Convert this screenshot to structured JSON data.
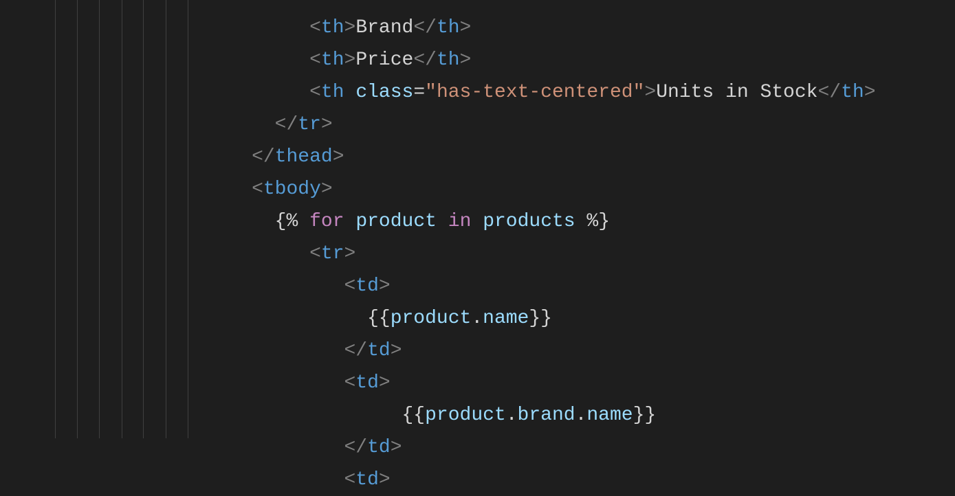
{
  "indent_guides": [
    50,
    82,
    114,
    147,
    178,
    211,
    243
  ],
  "lines": [
    {
      "indent": "                         ",
      "tokens": [
        {
          "cls": "bracket",
          "t": "<"
        },
        {
          "cls": "tag",
          "t": "th"
        },
        {
          "cls": "bracket",
          "t": ">"
        },
        {
          "cls": "text",
          "t": "Brand"
        },
        {
          "cls": "bracket",
          "t": "</"
        },
        {
          "cls": "tag",
          "t": "th"
        },
        {
          "cls": "bracket",
          "t": ">"
        }
      ]
    },
    {
      "indent": "                         ",
      "tokens": [
        {
          "cls": "bracket",
          "t": "<"
        },
        {
          "cls": "tag",
          "t": "th"
        },
        {
          "cls": "bracket",
          "t": ">"
        },
        {
          "cls": "text",
          "t": "Price"
        },
        {
          "cls": "bracket",
          "t": "</"
        },
        {
          "cls": "tag",
          "t": "th"
        },
        {
          "cls": "bracket",
          "t": ">"
        }
      ]
    },
    {
      "indent": "                         ",
      "tokens": [
        {
          "cls": "bracket",
          "t": "<"
        },
        {
          "cls": "tag",
          "t": "th"
        },
        {
          "cls": "text",
          "t": " "
        },
        {
          "cls": "attr",
          "t": "class"
        },
        {
          "cls": "text",
          "t": "="
        },
        {
          "cls": "string",
          "t": "\"has-text-centered\""
        },
        {
          "cls": "bracket",
          "t": ">"
        },
        {
          "cls": "text",
          "t": "Units in Stock"
        },
        {
          "cls": "bracket",
          "t": "</"
        },
        {
          "cls": "tag",
          "t": "th"
        },
        {
          "cls": "bracket",
          "t": ">"
        }
      ]
    },
    {
      "indent": "                      ",
      "tokens": [
        {
          "cls": "bracket",
          "t": "</"
        },
        {
          "cls": "tag",
          "t": "tr"
        },
        {
          "cls": "bracket",
          "t": ">"
        }
      ]
    },
    {
      "indent": "                    ",
      "tokens": [
        {
          "cls": "bracket",
          "t": "</"
        },
        {
          "cls": "tag",
          "t": "thead"
        },
        {
          "cls": "bracket",
          "t": ">"
        }
      ]
    },
    {
      "indent": "                    ",
      "tokens": [
        {
          "cls": "bracket",
          "t": "<"
        },
        {
          "cls": "tag",
          "t": "tbody"
        },
        {
          "cls": "bracket",
          "t": ">"
        }
      ]
    },
    {
      "indent": "                      ",
      "tokens": [
        {
          "cls": "delim",
          "t": "{% "
        },
        {
          "cls": "keyword",
          "t": "for"
        },
        {
          "cls": "text",
          "t": " "
        },
        {
          "cls": "varname",
          "t": "product"
        },
        {
          "cls": "text",
          "t": " "
        },
        {
          "cls": "keyword",
          "t": "in"
        },
        {
          "cls": "text",
          "t": " "
        },
        {
          "cls": "varname",
          "t": "products"
        },
        {
          "cls": "delim",
          "t": " %}"
        }
      ]
    },
    {
      "indent": "                         ",
      "tokens": [
        {
          "cls": "bracket",
          "t": "<"
        },
        {
          "cls": "tag",
          "t": "tr"
        },
        {
          "cls": "bracket",
          "t": ">"
        }
      ]
    },
    {
      "indent": "                            ",
      "tokens": [
        {
          "cls": "bracket",
          "t": "<"
        },
        {
          "cls": "tag",
          "t": "td"
        },
        {
          "cls": "bracket",
          "t": ">"
        }
      ]
    },
    {
      "indent": "                              ",
      "tokens": [
        {
          "cls": "delim",
          "t": "{{"
        },
        {
          "cls": "varname",
          "t": "product"
        },
        {
          "cls": "text",
          "t": "."
        },
        {
          "cls": "prop",
          "t": "name"
        },
        {
          "cls": "delim",
          "t": "}}"
        }
      ]
    },
    {
      "indent": "                            ",
      "tokens": [
        {
          "cls": "bracket",
          "t": "</"
        },
        {
          "cls": "tag",
          "t": "td"
        },
        {
          "cls": "bracket",
          "t": ">"
        }
      ]
    },
    {
      "indent": "                            ",
      "tokens": [
        {
          "cls": "bracket",
          "t": "<"
        },
        {
          "cls": "tag",
          "t": "td"
        },
        {
          "cls": "bracket",
          "t": ">"
        }
      ]
    },
    {
      "indent": "                                 ",
      "tokens": [
        {
          "cls": "delim",
          "t": "{{"
        },
        {
          "cls": "varname",
          "t": "product"
        },
        {
          "cls": "text",
          "t": "."
        },
        {
          "cls": "prop",
          "t": "brand"
        },
        {
          "cls": "text",
          "t": "."
        },
        {
          "cls": "prop",
          "t": "name"
        },
        {
          "cls": "delim",
          "t": "}}"
        }
      ]
    },
    {
      "indent": "                            ",
      "tokens": [
        {
          "cls": "bracket",
          "t": "</"
        },
        {
          "cls": "tag",
          "t": "td"
        },
        {
          "cls": "bracket",
          "t": ">"
        }
      ]
    },
    {
      "indent": "                            ",
      "tokens": [
        {
          "cls": "bracket",
          "t": "<"
        },
        {
          "cls": "tag",
          "t": "td"
        },
        {
          "cls": "bracket",
          "t": ">"
        }
      ]
    }
  ]
}
